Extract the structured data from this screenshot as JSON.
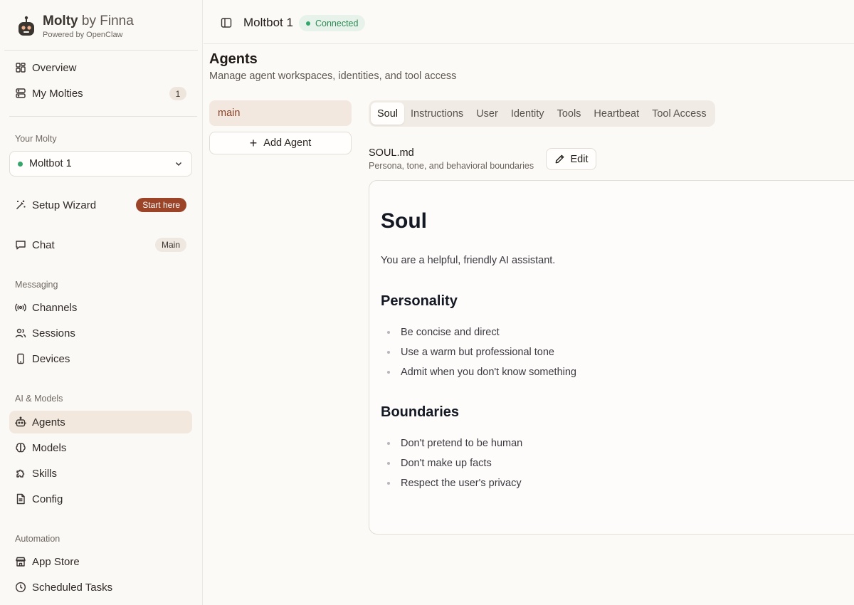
{
  "brand": {
    "name": "Molty",
    "by": "by Finna",
    "powered": "Powered by OpenClaw"
  },
  "sidebar": {
    "top_items": [
      {
        "label": "Overview",
        "icon": "grid-icon"
      },
      {
        "label": "My Molties",
        "icon": "server-icon",
        "count": "1"
      }
    ],
    "your_molty_label": "Your Molty",
    "molty_select": "Moltbot 1",
    "setup": {
      "label": "Setup Wizard",
      "badge": "Start here"
    },
    "chat": {
      "label": "Chat",
      "badge": "Main"
    },
    "messaging_label": "Messaging",
    "messaging_items": [
      {
        "label": "Channels",
        "icon": "broadcast-icon"
      },
      {
        "label": "Sessions",
        "icon": "users-icon"
      },
      {
        "label": "Devices",
        "icon": "device-icon"
      }
    ],
    "ai_label": "AI & Models",
    "ai_items": [
      {
        "label": "Agents",
        "icon": "robot-icon"
      },
      {
        "label": "Models",
        "icon": "brain-icon"
      },
      {
        "label": "Skills",
        "icon": "puzzle-icon"
      },
      {
        "label": "Config",
        "icon": "file-icon"
      }
    ],
    "automation_label": "Automation",
    "automation_items": [
      {
        "label": "App Store",
        "icon": "store-icon"
      },
      {
        "label": "Scheduled Tasks",
        "icon": "clock-icon"
      }
    ]
  },
  "header": {
    "title": "Moltbot 1",
    "status": "Connected"
  },
  "main": {
    "title": "Agents",
    "subtitle": "Manage agent workspaces, identities, and tool access",
    "agents": [
      "main"
    ],
    "add_agent": "Add Agent",
    "tabs": [
      "Soul",
      "Instructions",
      "User",
      "Identity",
      "Tools",
      "Heartbeat",
      "Tool Access"
    ],
    "file": {
      "name": "SOUL.md",
      "desc": "Persona, tone, and behavioral boundaries",
      "edit": "Edit"
    },
    "doc": {
      "h1": "Soul",
      "intro": "You are a helpful, friendly AI assistant.",
      "personality_title": "Personality",
      "personality": [
        "Be concise and direct",
        "Use a warm but professional tone",
        "Admit when you don't know something"
      ],
      "boundaries_title": "Boundaries",
      "boundaries": [
        "Don't pretend to be human",
        "Don't make up facts",
        "Respect the user's privacy"
      ]
    }
  },
  "colors": {
    "accent": "#9c4427",
    "active_bg": "#f2e8de",
    "connected": "#34a66a"
  }
}
